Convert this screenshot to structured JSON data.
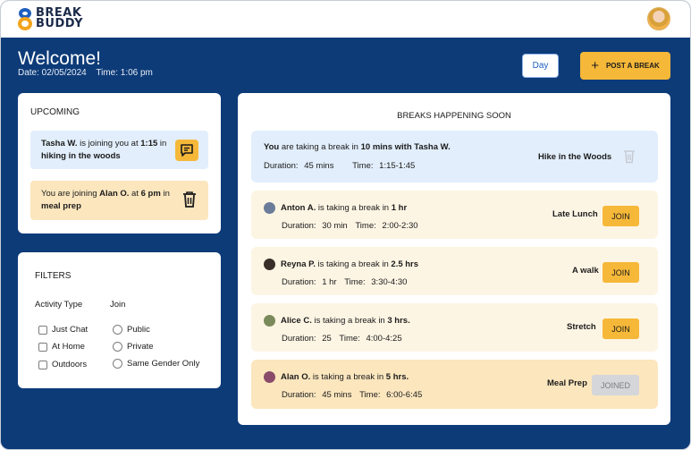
{
  "app": {
    "logo_line1": "BREAK",
    "logo_line2": "BUDDY"
  },
  "header": {
    "welcome": "Welcome!",
    "date_label": "Date: 02/05/2024",
    "time_label": "Time: 1:06 pm",
    "day_button": "Day",
    "post_button": "POST A BREAK",
    "post_icon": "+"
  },
  "upcoming": {
    "title": "UPCOMING",
    "items": [
      {
        "name": "Tasha W.",
        "mid": " is joining you at ",
        "time": "1:15",
        "pre2": " in ",
        "activity": "hiking in the woods",
        "icon": "message-icon"
      },
      {
        "pre": "You are joining ",
        "name": "Alan O.",
        "mid": " at ",
        "time": "6 pm",
        "pre2": " in ",
        "activity": "meal prep",
        "icon": "trash-icon"
      }
    ]
  },
  "filters": {
    "title": "FILTERS",
    "activity_heading": "Activity Type",
    "join_heading": "Join",
    "activity_options": [
      "Just Chat",
      "At Home",
      "Outdoors"
    ],
    "join_options": [
      "Public",
      "Private",
      "Same Gender Only"
    ]
  },
  "breaks": {
    "title": "BREAKS HAPPENING SOON",
    "own": {
      "you": "You",
      "text": " are taking a break in ",
      "bold": "10 mins with Tasha W.",
      "duration_label": "Duration:",
      "duration": "45 mins",
      "time_label": "Time:",
      "time": "1:15-1:45",
      "activity": "Hike in the Woods"
    },
    "rows": [
      {
        "name": "Anton A.",
        "text": " is taking a break in ",
        "amount": "1 hr",
        "duration_label": "Duration:",
        "duration": "30 min",
        "time_label": "Time:",
        "time": "2:00-2:30",
        "activity": "Late Lunch",
        "button": "JOIN"
      },
      {
        "name": "Reyna P.",
        "text": " is taking a break in ",
        "amount": "2.5 hrs",
        "duration_label": "Duration:",
        "duration": "1 hr",
        "time_label": "Time:",
        "time": "3:30-4:30",
        "activity": "A walk",
        "button": "JOIN"
      },
      {
        "name": "Alice C.",
        "text": " is taking a break in ",
        "amount": "3 hrs.",
        "duration_label": "Duration:",
        "duration": "25",
        "time_label": "Time:",
        "time": "4:00-4:25",
        "activity": "Stretch",
        "button": "JOIN"
      },
      {
        "name": "Alan O.",
        "text": " is taking a break in ",
        "amount": "5 hrs.",
        "duration_label": "Duration:",
        "duration": "45 mins",
        "time_label": "Time:",
        "time": "6:00-6:45",
        "activity": "Meal Prep",
        "button": "JOINED"
      }
    ]
  },
  "colors": {
    "navy": "#0d3b78",
    "accent": "#f6b839",
    "light_blue": "#e2eefb",
    "cream": "#fdf5e4"
  }
}
